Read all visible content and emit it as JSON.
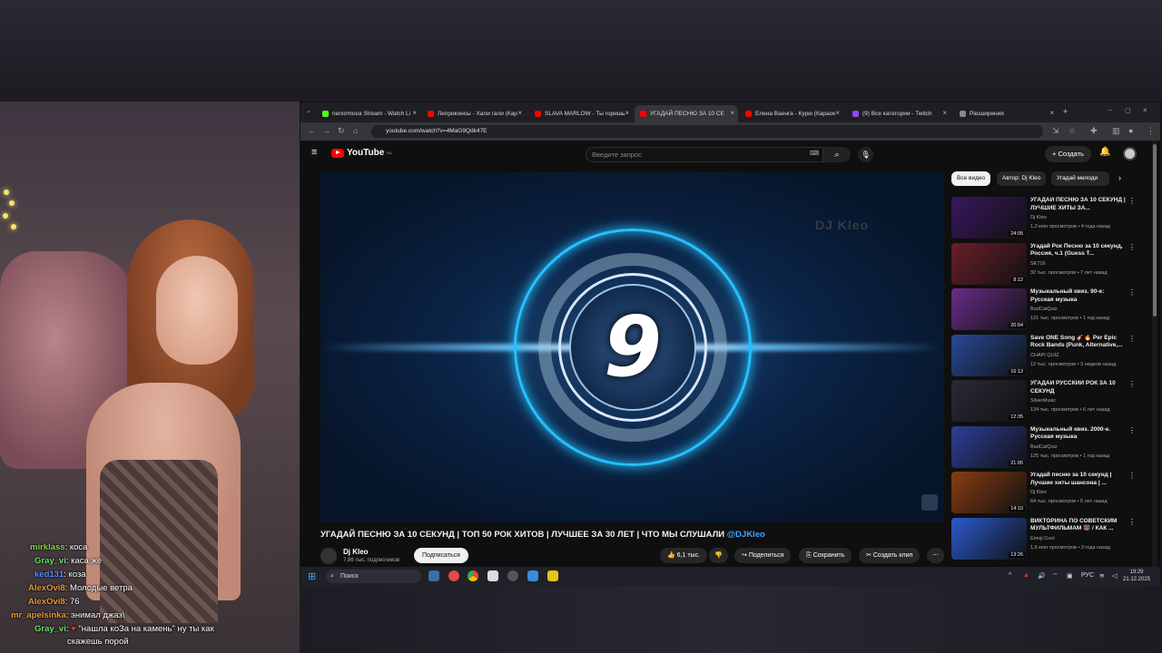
{
  "chat": [
    {
      "user": "mirklass",
      "color": "#7fdc3c",
      "msg": "коса"
    },
    {
      "user": "Gray_vi",
      "color": "#6ee06e",
      "msg": "каса же"
    },
    {
      "user": "ked131",
      "color": "#5b8cff",
      "msg": "коза"
    },
    {
      "user": "AlexOvi8",
      "color": "#e89a3c",
      "msg": "Молодые ветра"
    },
    {
      "user": "AlexOvi8",
      "color": "#e89a3c",
      "msg": "76"
    },
    {
      "user": "mr_apelsinka",
      "color": "#f09830",
      "msg": "энимал джаз\\"
    },
    {
      "user": "Gray_vi",
      "color": "#6ee06e",
      "msg": "\"нашла коЗа на камень\" ну ты как"
    },
    {
      "user": "",
      "color": "#ffffff",
      "msg": "скажешь порой"
    }
  ],
  "browser": {
    "tabs": [
      {
        "label": "nenormova Stream - Watch Li",
        "color": "#53fc18"
      },
      {
        "label": "Леприконсы - Хали гали (Кар",
        "color": "#ff0000"
      },
      {
        "label": "SLAVA MARLOW - Ты горишь",
        "color": "#ff0000"
      },
      {
        "label": "УГАДАЙ ПЕСНЮ ЗА 10 СЕ",
        "color": "#ff0000"
      },
      {
        "label": "Елена Ваенга - Курю (Караок",
        "color": "#ff0000"
      },
      {
        "label": "(9) Все категории - Twitch",
        "color": "#9146ff"
      },
      {
        "label": "Расширения",
        "color": "#888888"
      }
    ],
    "url": "youtube.com/watch?v=4MaG9Qdk47E"
  },
  "youtube": {
    "logo_text": "YouTube",
    "region": "RU",
    "search_placeholder": "Введите запрос",
    "create_label": "+ Создать",
    "video_number": "9",
    "watermark": "DJ Kleo",
    "title": "УГАДАЙ ПЕСНЮ ЗА 10 СЕКУНД | ТОП 50 РОК ХИТОВ | ЛУЧШЕЕ ЗА 30 ЛЕТ | ЧТО МЫ СЛУШАЛИ",
    "title_tag": "@DJKleo",
    "channel": "Dj Kleo",
    "subscribers": "7,86 тыс. подписчиков",
    "subscribe_label": "Подписаться",
    "likes": "6,1 тыс.",
    "share_label": "Поделиться",
    "save_label": "Сохранить",
    "clip_label": "Создать клип",
    "chips": [
      "Все видео",
      "Автор: Dj Kleo",
      "Угадай мелоди"
    ],
    "recommendations": [
      {
        "title": "УГАДАЙ ПЕСНЮ ЗА 10 СЕКУНД | ЛУЧШИЕ ХИТЫ ЗА...",
        "channel": "Dj Kleo",
        "views": "1,2 млн просмотров • 4 года назад",
        "duration": "24:05",
        "thumb": "#3a1760"
      },
      {
        "title": "Угадай Рок Песню за 10 секунд, Россия, ч.1 (Guess T...",
        "channel": "SK716",
        "views": "32 тыс. просмотров • 7 лет назад",
        "duration": "8:12",
        "thumb": "#6b1e2a"
      },
      {
        "title": "Музыкальный квиз. 90-е: Русская музыка",
        "channel": "BadCatQuiz",
        "views": "131 тыс. просмотров • 1 год назад",
        "duration": "20:04",
        "thumb": "#6a2c8a"
      },
      {
        "title": "Save ONE Song 🎸🔥 Per Epic Rock Bands (Punk, Alternative,...",
        "channel": "CHAPI QUIZ",
        "views": "12 тыс. просмотров • 3 недели назад",
        "duration": "16:12",
        "thumb": "#284a9a"
      },
      {
        "title": "УГАДАЙ РУССКИЙ РОК ЗА 10 СЕКУНД",
        "channel": "SilverMusic",
        "views": "134 тыс. просмотров • 6 лет назад",
        "duration": "12:35",
        "thumb": "#2a2a3a"
      },
      {
        "title": "Музыкальный квиз. 2000-е. Русская музыка",
        "channel": "BadCatQuiz",
        "views": "125 тыс. просмотров • 1 год назад",
        "duration": "21:05",
        "thumb": "#2d3f9a"
      },
      {
        "title": "Угадай песню за 10 секунд | Лучшие хиты шансона | ...",
        "channel": "Dj Kleo",
        "views": "64 тыс. просмотров • 5 лет назад",
        "duration": "14:10",
        "thumb": "#8a3c12"
      },
      {
        "title": "ВИКТОРИНА ПО СОВЕТСКИМ МУЛЬТФИЛЬМАМ 🐻 / КАК ...",
        "channel": "Emoji Cool",
        "views": "1,6 млн просмотров • 3 года назад",
        "duration": "13:26",
        "thumb": "#2c5ad0"
      }
    ]
  },
  "taskbar": {
    "search_label": "Поиск",
    "lang": "РУС",
    "time": "19:29",
    "date": "21.12.2025"
  }
}
